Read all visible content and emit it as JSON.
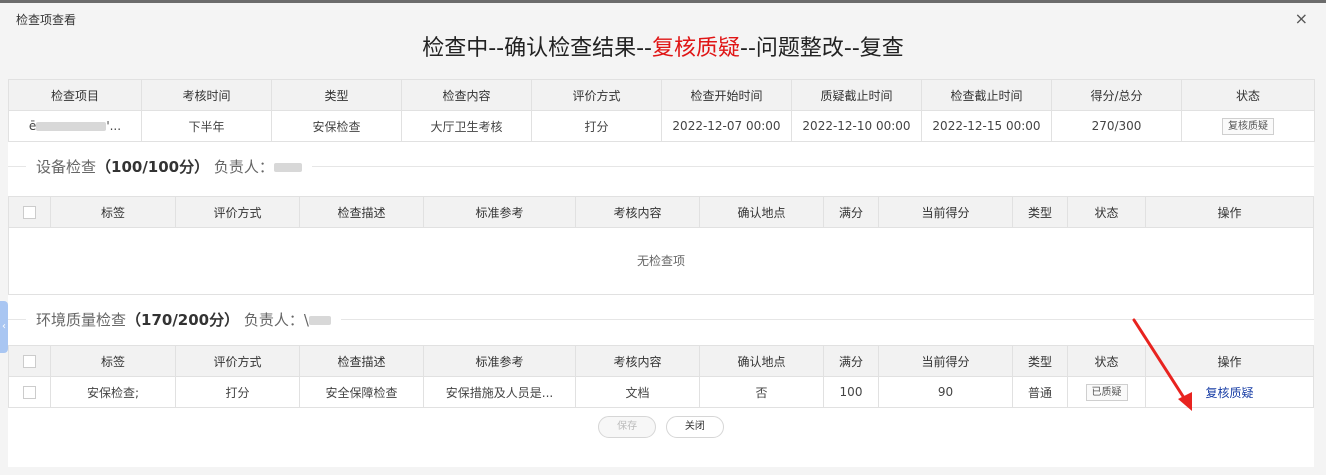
{
  "window": {
    "title": "检查项查看",
    "close_icon": "×"
  },
  "steps": {
    "part1": "检查中--确认检查结果--",
    "highlight": "复核质疑",
    "part2": "--问题整改--复查"
  },
  "summary": {
    "headers": [
      "检查项目",
      "考核时间",
      "类型",
      "检查内容",
      "评价方式",
      "检查开始时间",
      "质疑截止时间",
      "检查截止时间",
      "得分/总分",
      "状态"
    ],
    "row": {
      "item_prefix": "ē",
      "item_suffix": "'...",
      "period": "下半年",
      "type": "安保检查",
      "content": "大厅卫生考核",
      "method": "打分",
      "start": "2022-12-07 00:00",
      "challenge_deadline": "2022-12-10 00:00",
      "deadline": "2022-12-15 00:00",
      "score": "270/300",
      "status": "复核质疑"
    }
  },
  "section1": {
    "name": "设备检查",
    "score": "（100/100分）",
    "owner_label": "负责人：",
    "empty_text": "无检查项"
  },
  "section2": {
    "name": "环境质量检查",
    "score": "（170/200分）",
    "owner_label": "负责人：",
    "owner_mark": "\\"
  },
  "item_headers": [
    "标签",
    "评价方式",
    "检查描述",
    "标准参考",
    "考核内容",
    "确认地点",
    "满分",
    "当前得分",
    "类型",
    "状态",
    "操作"
  ],
  "section2_row": {
    "tag": "安保检查;",
    "method": "打分",
    "desc": "安全保障检查",
    "reference": "安保措施及人员是...",
    "content": "文档",
    "location": "否",
    "full": "100",
    "score": "90",
    "type": "普通",
    "status": "已质疑",
    "action": "复核质疑"
  },
  "footer": {
    "save": "保存",
    "close": "关闭"
  },
  "colors": {
    "highlight": "#e01515",
    "link": "#1a3fa6",
    "arrow": "#e8231f"
  }
}
